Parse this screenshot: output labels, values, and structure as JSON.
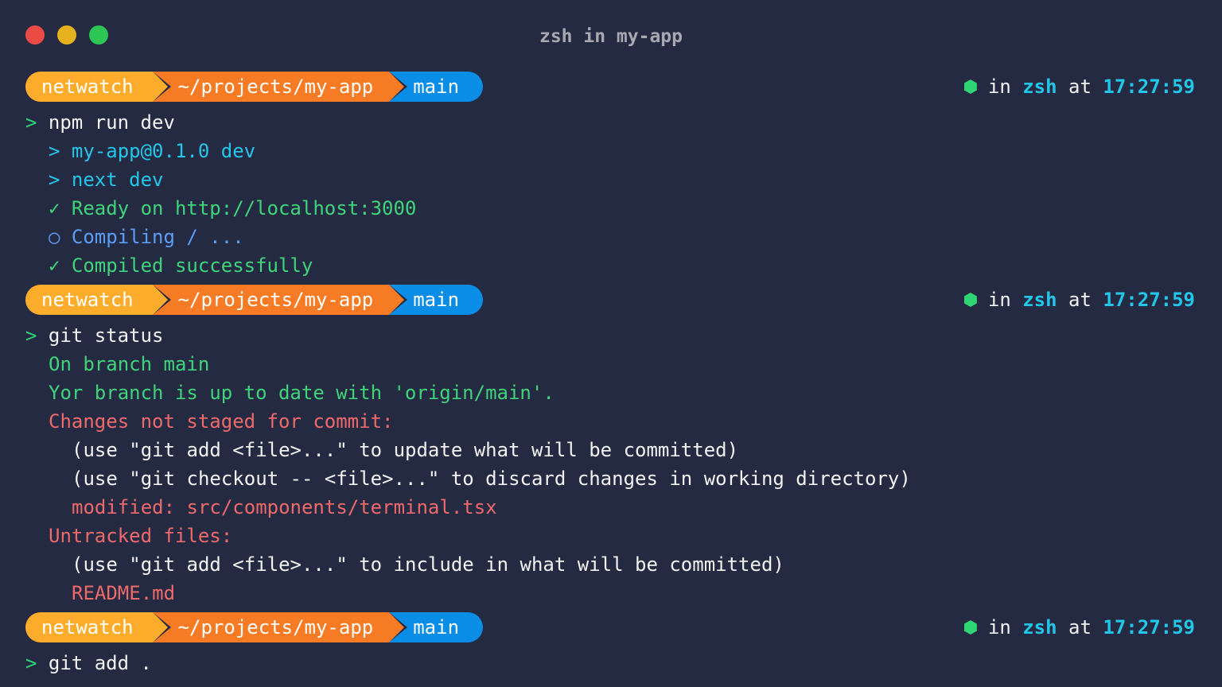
{
  "window": {
    "title": "zsh in my-app"
  },
  "prompt": {
    "user": "netwatch",
    "path": "~/projects/my-app",
    "branch": "main",
    "in_label": "in",
    "shell": "zsh",
    "at_label": "at",
    "time": "17:27:59"
  },
  "blocks": [
    {
      "command": "npm run dev",
      "output": [
        "> my-app@0.1.0 dev",
        "> next dev",
        "✓ Ready on http://localhost:3000",
        "○ Compiling / ...",
        "✓ Compiled successfully"
      ]
    },
    {
      "command": "git status",
      "output": [
        "On branch main",
        "Yor branch is up to date with 'origin/main'.",
        "Changes not staged for commit:",
        "(use \"git add <file>...\" to update what will be committed)",
        "(use \"git checkout -- <file>...\" to discard changes in working directory)",
        "modified: src/components/terminal.tsx",
        "Untracked files:",
        "(use \"git add <file>...\" to include in what will be committed)",
        "README.md"
      ]
    },
    {
      "command": "git add .",
      "output": []
    }
  ],
  "caret": ">",
  "colors": {
    "background": "#252a43",
    "user_segment": "#fdad2b",
    "path_segment": "#f77b24",
    "branch_segment": "#0a8de6",
    "accent_cyan": "#22c6e8",
    "success_green": "#3ed47a",
    "info_blue": "#5a9ef5",
    "error_red": "#ee6a6a"
  },
  "icons": {
    "status": "hexagon-icon"
  }
}
